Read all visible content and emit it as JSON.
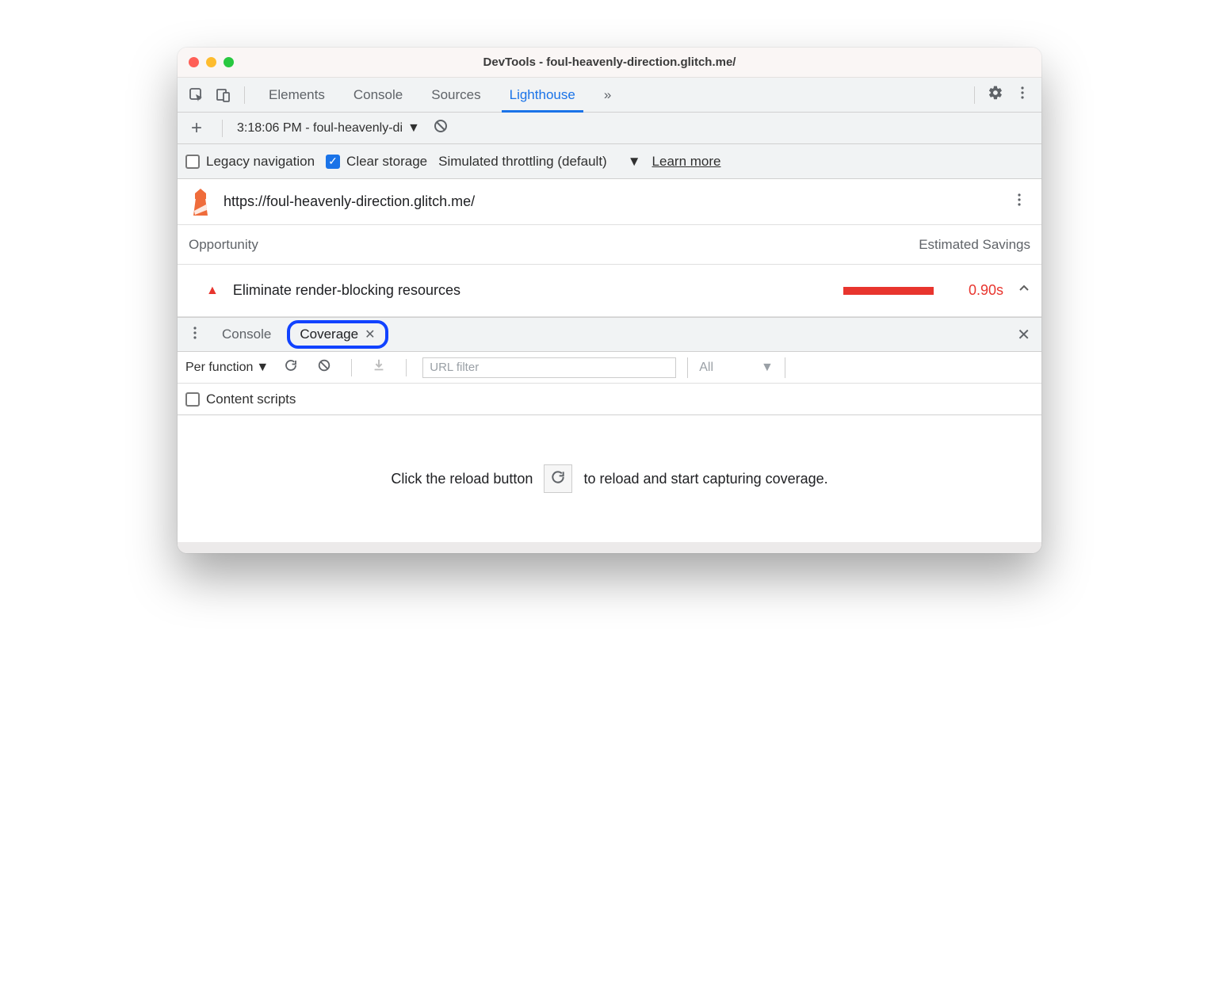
{
  "window": {
    "title": "DevTools - foul-heavenly-direction.glitch.me/"
  },
  "tabs": {
    "items": [
      "Elements",
      "Console",
      "Sources",
      "Lighthouse"
    ],
    "active": "Lighthouse"
  },
  "lighthouse": {
    "report_select": "3:18:06 PM - foul-heavenly-di",
    "options": {
      "legacy_nav_label": "Legacy navigation",
      "legacy_nav_checked": false,
      "clear_storage_label": "Clear storage",
      "clear_storage_checked": true,
      "throttling_label": "Simulated throttling (default)",
      "learn_more": "Learn more"
    },
    "url": "https://foul-heavenly-direction.glitch.me/",
    "headers": {
      "opportunity": "Opportunity",
      "estimated": "Estimated Savings"
    },
    "opportunity": {
      "label": "Eliminate render-blocking resources",
      "savings": "0.90s"
    }
  },
  "drawer": {
    "tabs": {
      "console": "Console",
      "coverage": "Coverage"
    },
    "coverage": {
      "granularity": "Per function",
      "url_filter_placeholder": "URL filter",
      "type_filter": "All",
      "content_scripts_label": "Content scripts",
      "content_scripts_checked": false,
      "empty_pre": "Click the reload button",
      "empty_post": "to reload and start capturing coverage."
    }
  }
}
